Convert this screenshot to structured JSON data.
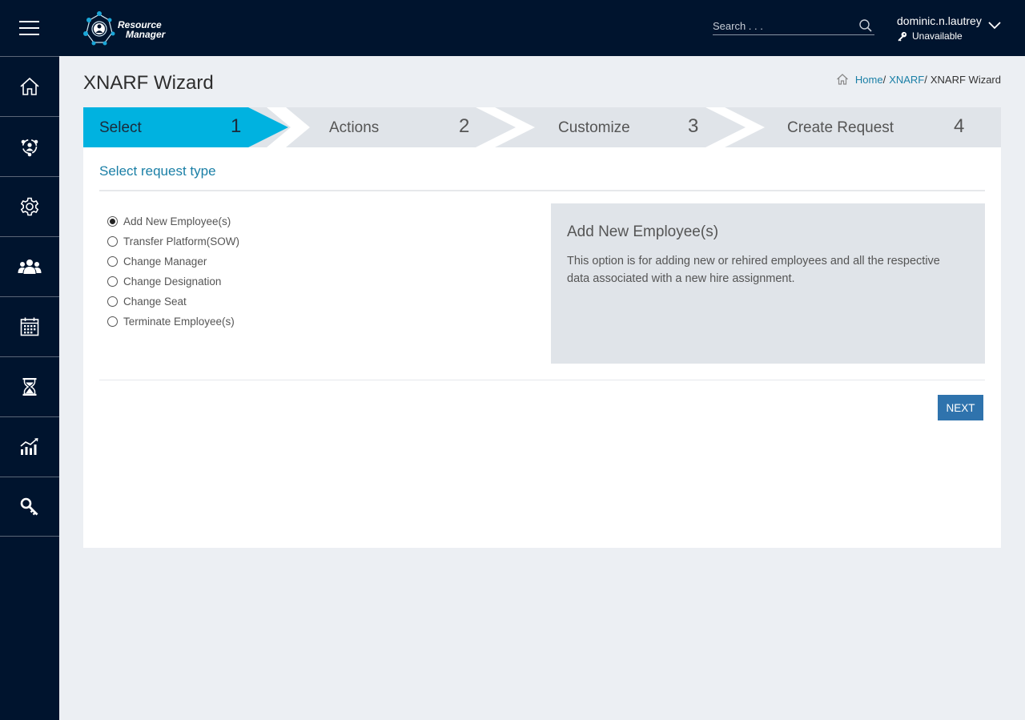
{
  "app": {
    "logo_line1": "Resource",
    "logo_line2": "Manager"
  },
  "header": {
    "search_placeholder": "Search . . .",
    "user_name": "dominic.n.lautrey",
    "user_status": "Unavailable"
  },
  "sidebar": {
    "items": [
      {
        "icon": "home-icon"
      },
      {
        "icon": "network-people-icon"
      },
      {
        "icon": "gear-icon"
      },
      {
        "icon": "team-icon"
      },
      {
        "icon": "calendar-icon"
      },
      {
        "icon": "hourglass-icon"
      },
      {
        "icon": "chart-icon"
      },
      {
        "icon": "key-icon"
      }
    ]
  },
  "page": {
    "title": "XNARF Wizard",
    "breadcrumb": {
      "home": "Home",
      "sep": "/",
      "xnarf": "XNARF",
      "current": "XNARF Wizard"
    }
  },
  "wizard": {
    "steps": [
      {
        "label": "Select",
        "number": "1",
        "active": true
      },
      {
        "label": "Actions",
        "number": "2",
        "active": false
      },
      {
        "label": "Customize",
        "number": "3",
        "active": false
      },
      {
        "label": "Create Request",
        "number": "4",
        "active": false
      }
    ],
    "section_title": "Select request type",
    "options": [
      {
        "label": "Add New Employee(s)",
        "checked": true
      },
      {
        "label": "Transfer Platform(SOW)",
        "checked": false
      },
      {
        "label": "Change Manager",
        "checked": false
      },
      {
        "label": "Change Designation",
        "checked": false
      },
      {
        "label": "Change Seat",
        "checked": false
      },
      {
        "label": "Terminate Employee(s)",
        "checked": false
      }
    ],
    "info": {
      "title": "Add New Employee(s)",
      "description": "This option is for adding new or rehired employees and all the respective data associated with a new hire assignment."
    },
    "next_label": "NEXT"
  },
  "colors": {
    "nav_bg": "#00142e",
    "active_step": "#00b2e0",
    "accent_text": "#1a7fa6",
    "button": "#2f73ad"
  }
}
